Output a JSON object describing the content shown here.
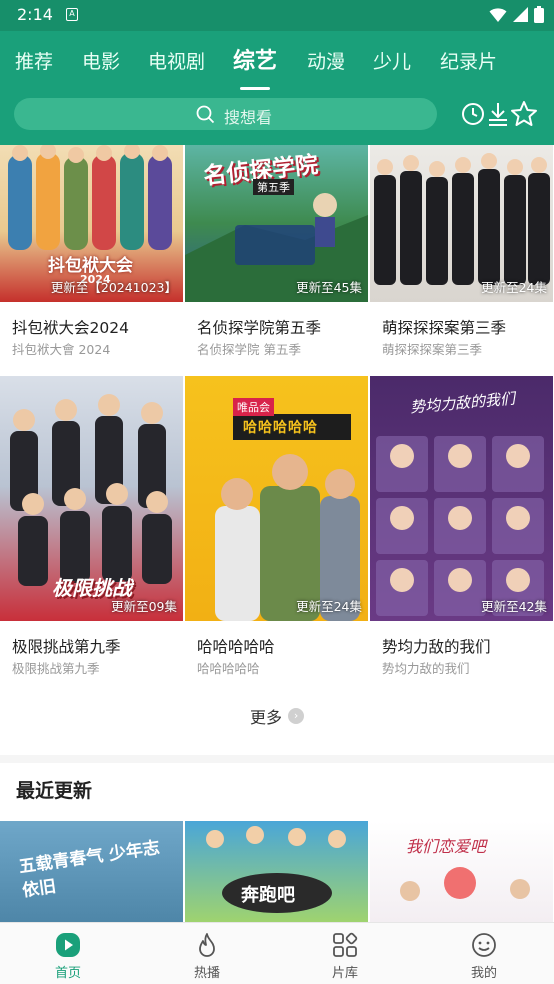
{
  "status_bar": {
    "time": "2:14",
    "notification_glyph": "A"
  },
  "tabs": [
    {
      "label": "推荐"
    },
    {
      "label": "电影"
    },
    {
      "label": "电视剧"
    },
    {
      "label": "综艺",
      "active": true
    },
    {
      "label": "动漫"
    },
    {
      "label": "少儿"
    },
    {
      "label": "纪录片"
    }
  ],
  "search": {
    "placeholder": "搜想看"
  },
  "header_icons": [
    "history-icon",
    "download-icon",
    "favorite-star-icon"
  ],
  "cards": [
    {
      "title": "抖包袱大会2024",
      "subtitle": "抖包袱大會 2024",
      "badge": "更新至【20241023】",
      "poster_text": "抖包袱大会",
      "poster_year": "2024"
    },
    {
      "title": "名侦探学院第五季",
      "subtitle": "名侦探学院 第五季",
      "badge": "更新至45集",
      "poster_text": "名侦探学院",
      "poster_season": "第五季"
    },
    {
      "title": "萌探探探案第三季",
      "subtitle": "萌探探探案第三季",
      "badge": "更新至24集"
    },
    {
      "title": "极限挑战第九季",
      "subtitle": "极限挑战第九季",
      "badge": "更新至09集",
      "poster_text": "极限挑战"
    },
    {
      "title": "哈哈哈哈哈",
      "subtitle": "哈哈哈哈哈",
      "badge": "更新至24集",
      "poster_text": "哈哈哈哈哈",
      "poster_tag": "唯品会"
    },
    {
      "title": "势均力敌的我们",
      "subtitle": "势均力敌的我们",
      "badge": "更新至42集",
      "poster_text": "势均力敌的我们"
    }
  ],
  "more_label": "更多",
  "recent_section": {
    "title": "最近更新",
    "posters": [
      {
        "poster_text": "五载青春气 少年志依旧"
      },
      {
        "poster_text": "奔跑吧"
      },
      {
        "poster_text": "我们恋爱吧"
      }
    ]
  },
  "bottom_nav": [
    {
      "label": "首页",
      "icon": "home-play-icon",
      "active": true
    },
    {
      "label": "热播",
      "icon": "flame-icon"
    },
    {
      "label": "片库",
      "icon": "library-grid-icon"
    },
    {
      "label": "我的",
      "icon": "profile-smile-icon"
    }
  ],
  "colors": {
    "brand": "#1aa07a",
    "status_bar": "#178f6a",
    "search_bg": "#3ab790"
  }
}
